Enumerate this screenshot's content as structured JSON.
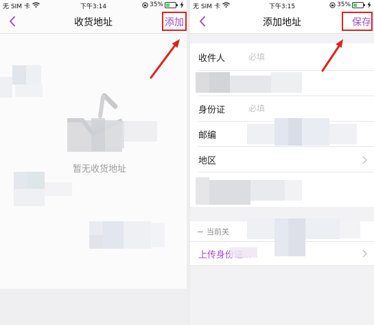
{
  "annotation_color": "#e02020",
  "accent_color": "#a04dc9",
  "left_screen": {
    "status_bar": {
      "carrier": "无 SIM 卡",
      "wifi_icon": "wifi-icon",
      "time": "下午3:14",
      "lock_icon": "orientation-lock-icon",
      "battery": "35%",
      "battery_icon": "battery-icon",
      "charging_icon": "bolt-icon"
    },
    "nav": {
      "back_icon": "chevron-left-icon",
      "title": "收货地址",
      "action_label": "添加"
    },
    "empty_state": {
      "icon": "empty-address-icon",
      "text": "暂无收货地址"
    }
  },
  "right_screen": {
    "status_bar": {
      "carrier": "无 SIM 卡",
      "wifi_icon": "wifi-icon",
      "time": "下午3:15",
      "lock_icon": "orientation-lock-icon",
      "battery": "35%",
      "battery_icon": "battery-icon",
      "charging_icon": "bolt-icon"
    },
    "nav": {
      "back_icon": "chevron-left-icon",
      "title": "添加地址",
      "action_label": "保存"
    },
    "form": {
      "fields": [
        {
          "label": "收件人",
          "placeholder": "必填"
        },
        {
          "label": "身份证",
          "placeholder": "必填"
        },
        {
          "label": "邮编"
        },
        {
          "label": "地区",
          "chevron_icon": "chevron-right-icon"
        }
      ],
      "default_toggle_label": "当前关",
      "upload_id_link": "上传身份证...",
      "upload_chevron_icon": "chevron-right-icon"
    }
  }
}
